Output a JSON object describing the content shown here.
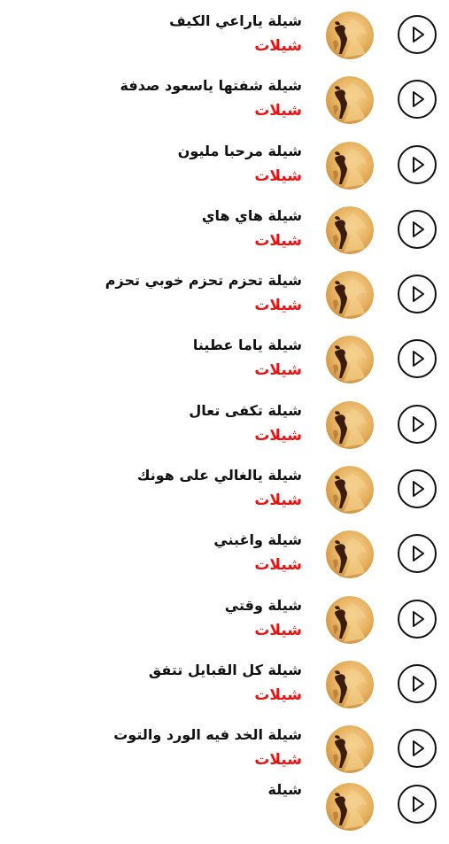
{
  "songs": {
    "items": [
      {
        "title": "شيلة ياراعي الكيف",
        "subtitle": "شيلات"
      },
      {
        "title": "شيلة شفتها ياسعود صدفة",
        "subtitle": "شيلات"
      },
      {
        "title": "شيلة مرحبا مليون",
        "subtitle": "شيلات"
      },
      {
        "title": "شيلة هاي هاي",
        "subtitle": "شيلات"
      },
      {
        "title": "شيلة تحزم تحزم خوبي تحزم",
        "subtitle": "شيلات"
      },
      {
        "title": "شيلة ياما عطينا",
        "subtitle": "شيلات"
      },
      {
        "title": "شيلة تكفى تعال",
        "subtitle": "شيلات"
      },
      {
        "title": "شيلة يالغالي على هونك",
        "subtitle": "شيلات"
      },
      {
        "title": "شيلة واغبني",
        "subtitle": "شيلات"
      },
      {
        "title": "شيلة وقتي",
        "subtitle": "شيلات"
      },
      {
        "title": "شيلة كل القبايل تتفق",
        "subtitle": "شيلات"
      },
      {
        "title": "شيلة الخد فيه الورد والتوت",
        "subtitle": "شيلات"
      }
    ],
    "partial_next_title": "شيلة"
  },
  "icons": {
    "play": "play-icon",
    "avatar": "horse-desert-thumbnail"
  },
  "colors": {
    "title": "#111111",
    "subtitle": "#ee1111",
    "background": "#ffffff"
  }
}
